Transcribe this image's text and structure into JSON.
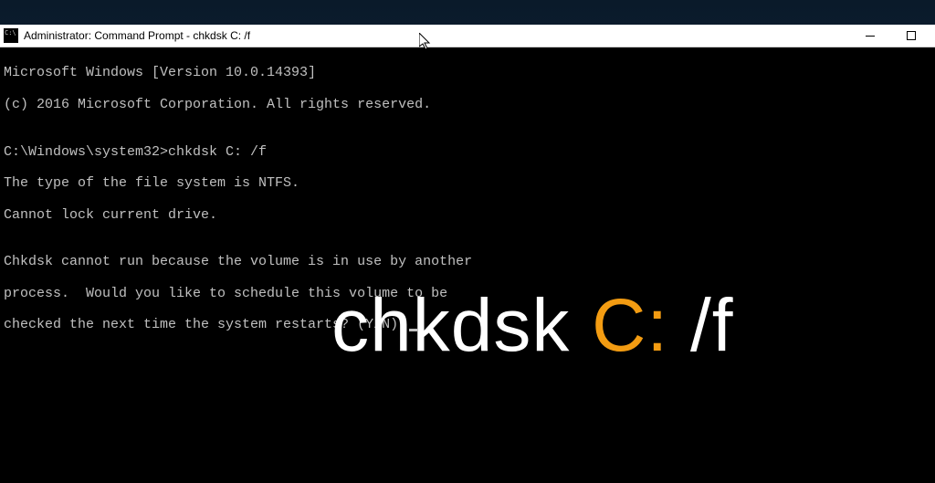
{
  "window": {
    "title": "Administrator: Command Prompt - chkdsk C: /f"
  },
  "terminal": {
    "line1": "Microsoft Windows [Version 10.0.14393]",
    "line2": "(c) 2016 Microsoft Corporation. All rights reserved.",
    "blank1": "",
    "line3": "C:\\Windows\\system32>chkdsk C: /f",
    "line4": "The type of the file system is NTFS.",
    "line5": "Cannot lock current drive.",
    "blank2": "",
    "line6": "Chkdsk cannot run because the volume is in use by another",
    "line7": "process.  Would you like to schedule this volume to be",
    "line8": "checked the next time the system restarts? (Y/N) "
  },
  "overlay": {
    "part1": "chkdsk ",
    "part2": "C:",
    "part3": " /f"
  }
}
